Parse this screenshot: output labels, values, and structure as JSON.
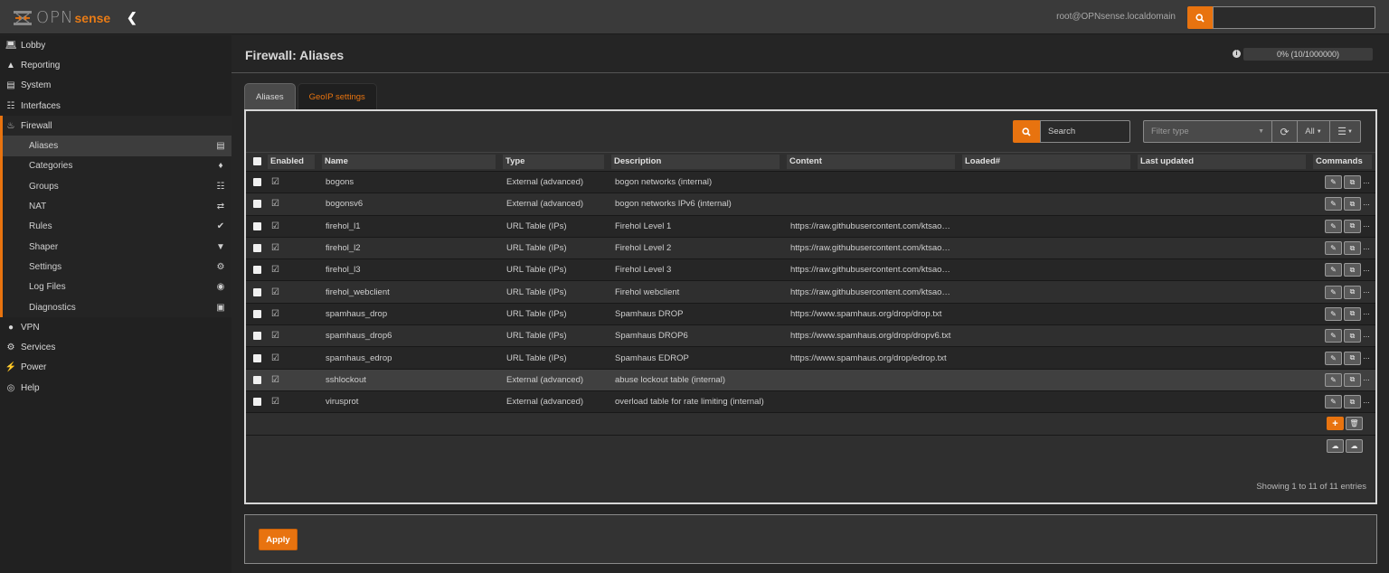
{
  "header": {
    "logo_text": "OPN",
    "logo_sense": "sense",
    "collapse_icon": "chevron-left-icon",
    "user": "root@OPNsense.localdomain",
    "search_placeholder": ""
  },
  "sidebar": {
    "items": [
      {
        "label": "Lobby",
        "icon": "laptop-icon"
      },
      {
        "label": "Reporting",
        "icon": "area-chart-icon"
      },
      {
        "label": "System",
        "icon": "server-icon"
      },
      {
        "label": "Interfaces",
        "icon": "sitemap-icon"
      },
      {
        "label": "Firewall",
        "icon": "fire-icon"
      },
      {
        "label": "VPN",
        "icon": "globe-icon"
      },
      {
        "label": "Services",
        "icon": "cog-icon"
      },
      {
        "label": "Power",
        "icon": "plug-icon"
      },
      {
        "label": "Help",
        "icon": "life-ring-icon"
      }
    ],
    "firewall_sub": [
      {
        "label": "Aliases",
        "icon": "list-alt-icon",
        "active": true
      },
      {
        "label": "Categories",
        "icon": "tags-icon"
      },
      {
        "label": "Groups",
        "icon": "sitemap-icon"
      },
      {
        "label": "NAT",
        "icon": "exchange-icon"
      },
      {
        "label": "Rules",
        "icon": "check-icon"
      },
      {
        "label": "Shaper",
        "icon": "filter-icon"
      },
      {
        "label": "Settings",
        "icon": "cogs-icon"
      },
      {
        "label": "Log Files",
        "icon": "eye-icon"
      },
      {
        "label": "Diagnostics",
        "icon": "medkit-icon"
      }
    ]
  },
  "page": {
    "title": "Firewall: Aliases",
    "usage_label": "0% (10/1000000)",
    "usage_percent": 0.001
  },
  "tabs": [
    {
      "label": "Aliases",
      "active": true
    },
    {
      "label": "GeoIP settings",
      "active": false
    }
  ],
  "toolbar": {
    "search_placeholder": "Search",
    "filter_type_placeholder": "Filter type",
    "all_label": "All"
  },
  "table": {
    "columns": [
      "Enabled",
      "Name",
      "Type",
      "Description",
      "Content",
      "Loaded#",
      "Last updated",
      "Commands"
    ],
    "rows": [
      {
        "name": "bogons",
        "type": "External (advanced)",
        "description": "bogon networks (internal)",
        "content": "",
        "loaded": "",
        "updated": ""
      },
      {
        "name": "bogonsv6",
        "type": "External (advanced)",
        "description": "bogon networks IPv6 (internal)",
        "content": "",
        "loaded": "",
        "updated": ""
      },
      {
        "name": "firehol_l1",
        "type": "URL Table (IPs)",
        "description": "Firehol Level 1",
        "content": "https://raw.githubusercontent.com/ktsao…",
        "loaded": "",
        "updated": ""
      },
      {
        "name": "firehol_l2",
        "type": "URL Table (IPs)",
        "description": "Firehol Level 2",
        "content": "https://raw.githubusercontent.com/ktsao…",
        "loaded": "",
        "updated": ""
      },
      {
        "name": "firehol_l3",
        "type": "URL Table (IPs)",
        "description": "Firehol Level 3",
        "content": "https://raw.githubusercontent.com/ktsao…",
        "loaded": "",
        "updated": ""
      },
      {
        "name": "firehol_webclient",
        "type": "URL Table (IPs)",
        "description": "Firehol webclient",
        "content": "https://raw.githubusercontent.com/ktsao…",
        "loaded": "",
        "updated": ""
      },
      {
        "name": "spamhaus_drop",
        "type": "URL Table (IPs)",
        "description": "Spamhaus DROP",
        "content": "https://www.spamhaus.org/drop/drop.txt",
        "loaded": "",
        "updated": ""
      },
      {
        "name": "spamhaus_drop6",
        "type": "URL Table (IPs)",
        "description": "Spamhaus DROP6",
        "content": "https://www.spamhaus.org/drop/dropv6.txt",
        "loaded": "",
        "updated": ""
      },
      {
        "name": "spamhaus_edrop",
        "type": "URL Table (IPs)",
        "description": "Spamhaus EDROP",
        "content": "https://www.spamhaus.org/drop/edrop.txt",
        "loaded": "",
        "updated": ""
      },
      {
        "name": "sshlockout",
        "type": "External (advanced)",
        "description": "abuse lockout table (internal)",
        "content": "",
        "loaded": "",
        "updated": ""
      },
      {
        "name": "virusprot",
        "type": "External (advanced)",
        "description": "overload table for rate limiting (internal)",
        "content": "",
        "loaded": "",
        "updated": ""
      }
    ],
    "footer": "Showing 1 to 11 of 11 entries"
  },
  "apply_label": "Apply",
  "colors": {
    "accent": "#e8730f"
  }
}
